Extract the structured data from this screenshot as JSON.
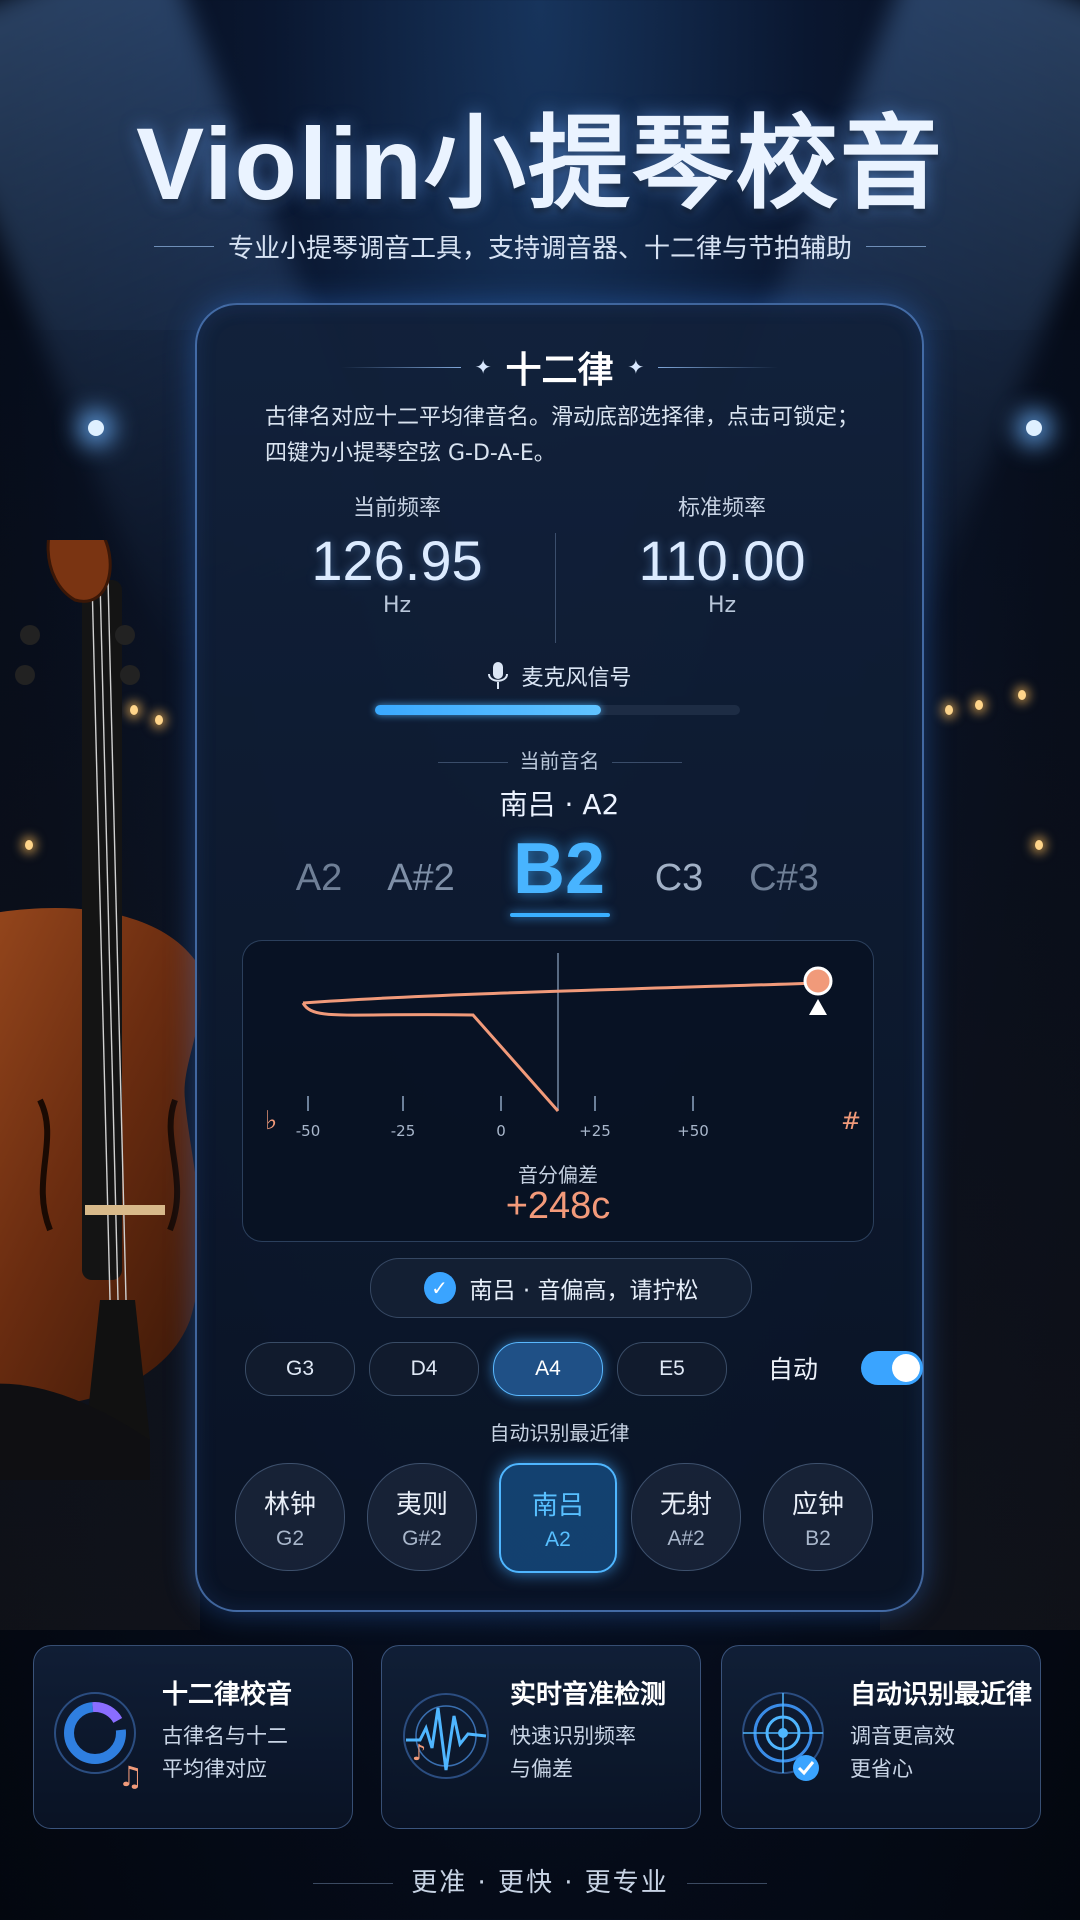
{
  "header": {
    "title": "Violin小提琴校音",
    "subtitle": "专业小提琴调音工具，支持调音器、十二律与节拍辅助"
  },
  "card": {
    "title": "十二律",
    "description": "古律名对应十二平均律音名。滑动底部选择律，点击可锁定；四键为小提琴空弦 G-D-A-E。",
    "current_freq_label": "当前频率",
    "current_freq_value": "126.95",
    "current_freq_unit": "Hz",
    "standard_freq_label": "标准频率",
    "standard_freq_value": "110.00",
    "standard_freq_unit": "Hz",
    "mic_label": "麦克风信号",
    "mic_level": 0.62,
    "current_note_label": "当前音名",
    "current_note_name": "南吕 · A2",
    "note_carousel": [
      "A2",
      "A#2",
      "B2",
      "C3",
      "C#3"
    ],
    "selected_note_index": 2,
    "meter": {
      "flat_symbol": "♭",
      "sharp_symbol": "#",
      "ticks": [
        "-50",
        "-25",
        "0",
        "+25",
        "+50"
      ],
      "cents_label": "音分偏差",
      "cents_value": "+248c",
      "line_color": "#f19a7a"
    },
    "status_text": "南吕 · 音偏高，请拧松",
    "strings": [
      "G3",
      "D4",
      "A4",
      "E5"
    ],
    "active_string": "A4",
    "auto_label": "自动",
    "auto_on": true,
    "auto_caption": "自动识别最近律",
    "lu_items": [
      {
        "cn": "林钟",
        "en": "G2"
      },
      {
        "cn": "夷则",
        "en": "G#2"
      },
      {
        "cn": "南吕",
        "en": "A2"
      },
      {
        "cn": "无射",
        "en": "A#2"
      },
      {
        "cn": "应钟",
        "en": "B2"
      }
    ],
    "active_lu_index": 2
  },
  "features": [
    {
      "title": "十二律校音",
      "line1": "古律名与十二",
      "line2": "平均律对应",
      "icon": "dial-note-icon"
    },
    {
      "title": "实时音准检测",
      "line1": "快速识别频率",
      "line2": "与偏差",
      "icon": "waveform-icon"
    },
    {
      "title": "自动识别最近律",
      "line1": "调音更高效",
      "line2": "更省心",
      "icon": "target-check-icon"
    }
  ],
  "footer": "更准 · 更快 · 更专业",
  "colors": {
    "accent": "#3aa4ff",
    "warm": "#f19a7a",
    "background": "#050b18"
  }
}
